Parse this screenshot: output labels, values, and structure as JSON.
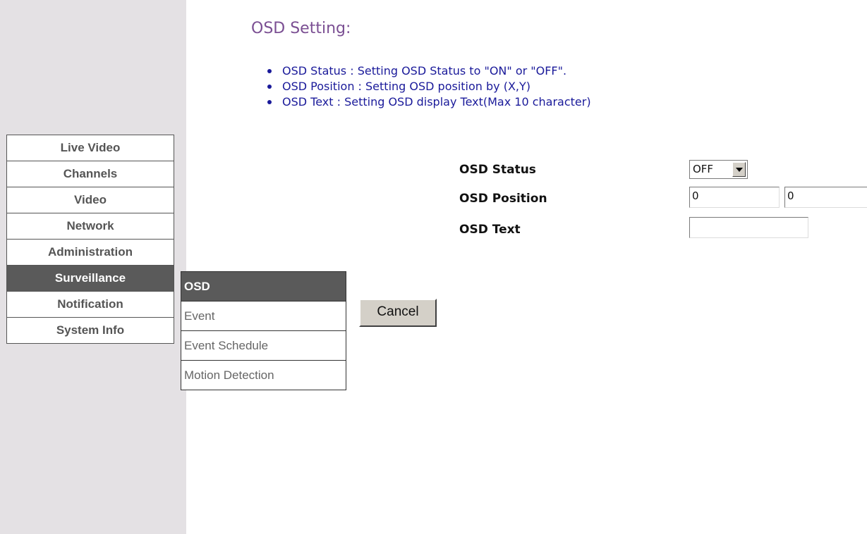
{
  "nav": {
    "items": [
      {
        "label": "Live Video"
      },
      {
        "label": "Channels"
      },
      {
        "label": "Video"
      },
      {
        "label": "Network"
      },
      {
        "label": "Administration"
      },
      {
        "label": "Surveillance",
        "active": true
      },
      {
        "label": "Notification"
      },
      {
        "label": "System Info"
      }
    ]
  },
  "submenu": {
    "items": [
      {
        "label": "OSD",
        "active": true
      },
      {
        "label": "Event"
      },
      {
        "label": "Event Schedule"
      },
      {
        "label": "Motion Detection"
      }
    ]
  },
  "main": {
    "title": "OSD Setting:",
    "help": [
      "OSD Status : Setting OSD Status to \"ON\" or \"OFF\".",
      "OSD Position : Setting OSD position by (X,Y)",
      "OSD Text : Setting OSD display Text(Max 10 character)"
    ],
    "form": {
      "status_label": "OSD Status",
      "status_value": "OFF",
      "position_label": "OSD Position",
      "position_x": "0",
      "position_y": "0",
      "text_label": "OSD Text",
      "text_value": ""
    },
    "cancel_label": "Cancel"
  },
  "colors": {
    "sidebar_bg": "#e4e1e4",
    "active_menu_bg": "#5a5a5a",
    "title": "#7b4f93",
    "help_text": "#1a1a9a"
  },
  "icons": {
    "select_arrow": "chevron-down-icon",
    "bullet": "bullet-icon"
  }
}
